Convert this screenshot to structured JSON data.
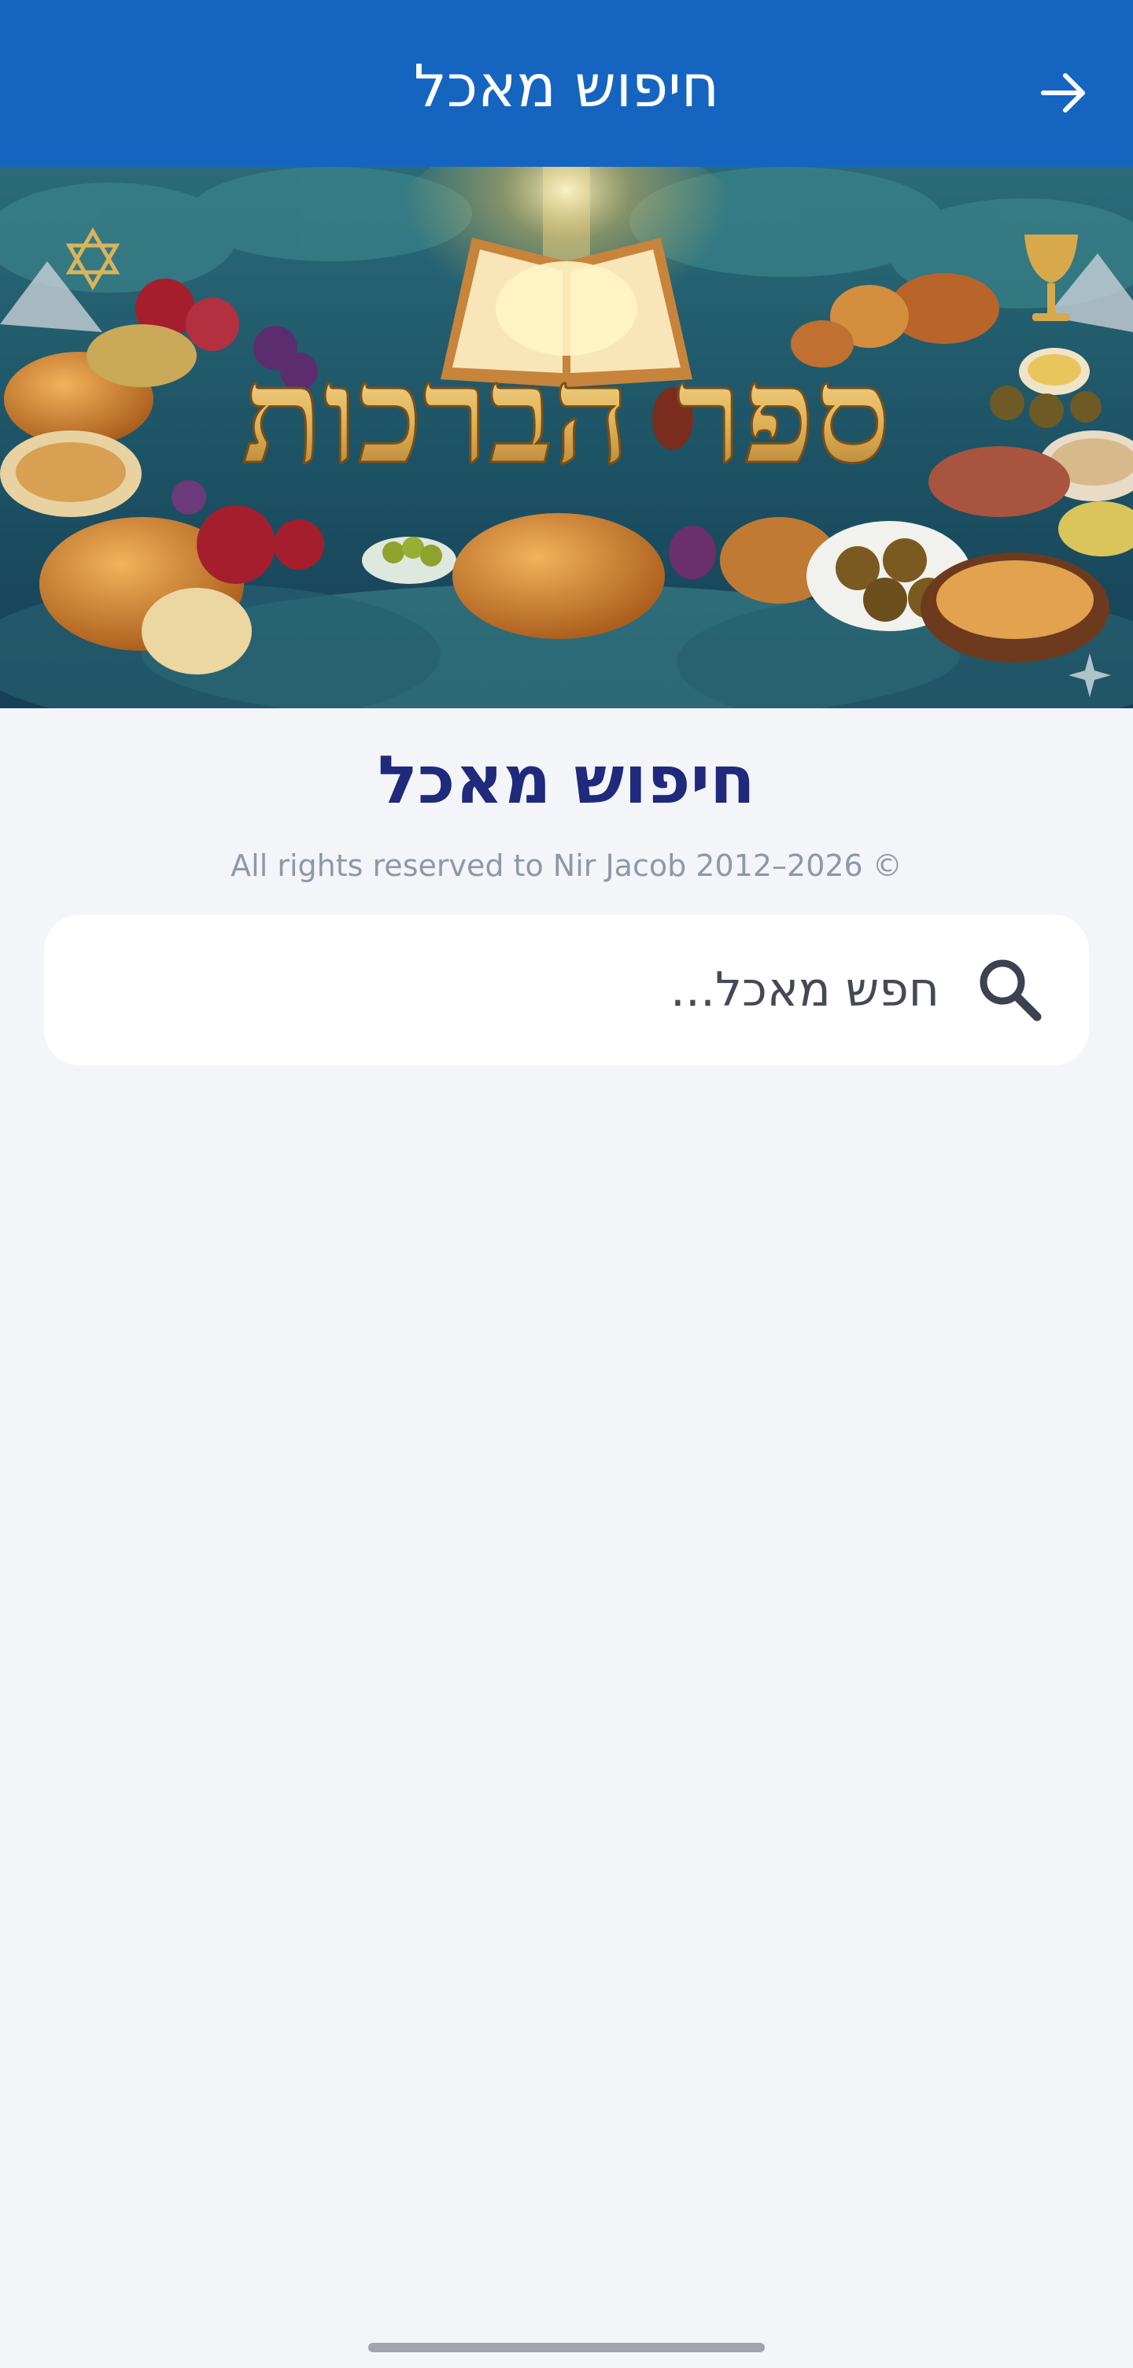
{
  "app_bar": {
    "title": "חיפוש מאכל",
    "back_icon": "arrow-right-icon",
    "background": "#1565c0"
  },
  "banner": {
    "title_text": "ספר הברכות",
    "icons": [
      "star-of-david-icon",
      "sparkle-icon",
      "open-book-icon",
      "goblet-icon"
    ]
  },
  "page": {
    "title": "חיפוש מאכל",
    "copyright": "All rights reserved to Nir Jacob 2012–2026 ©",
    "title_color": "#1f2a7c"
  },
  "search": {
    "placeholder": "חפש מאכל...",
    "value": "",
    "icon": "search-icon"
  }
}
